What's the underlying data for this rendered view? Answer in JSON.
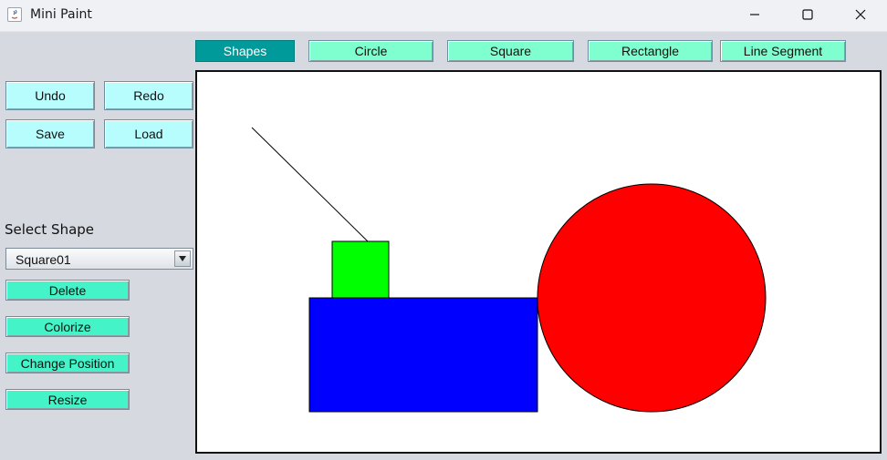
{
  "window": {
    "title": "Mini Paint",
    "icons": [
      "java-icon",
      "minimize-icon",
      "maximize-icon",
      "close-icon"
    ]
  },
  "toolbar": {
    "shapes_label": "Shapes",
    "circle_label": "Circle",
    "square_label": "Square",
    "rectangle_label": "Rectangle",
    "line_label": "Line Segment"
  },
  "sidebar": {
    "undo_label": "Undo",
    "redo_label": "Redo",
    "save_label": "Save",
    "load_label": "Load",
    "select_shape_label": "Select Shape",
    "selected_shape": "Square01",
    "delete_label": "Delete",
    "colorize_label": "Colorize",
    "change_position_label": "Change Position",
    "resize_label": "Resize"
  },
  "canvas": {
    "shapes": [
      {
        "type": "line",
        "color": "#000000"
      },
      {
        "type": "square",
        "color": "#00ff00"
      },
      {
        "type": "rectangle",
        "color": "#0000ff"
      },
      {
        "type": "circle",
        "color": "#ff0000"
      }
    ]
  },
  "colors": {
    "shapes_button": "#009a9a",
    "toolbar_buttons": "#7fffd0",
    "action_buttons": "#b7fdfe",
    "edit_buttons": "#44f3c8",
    "window_background": "#d6d9e0"
  }
}
